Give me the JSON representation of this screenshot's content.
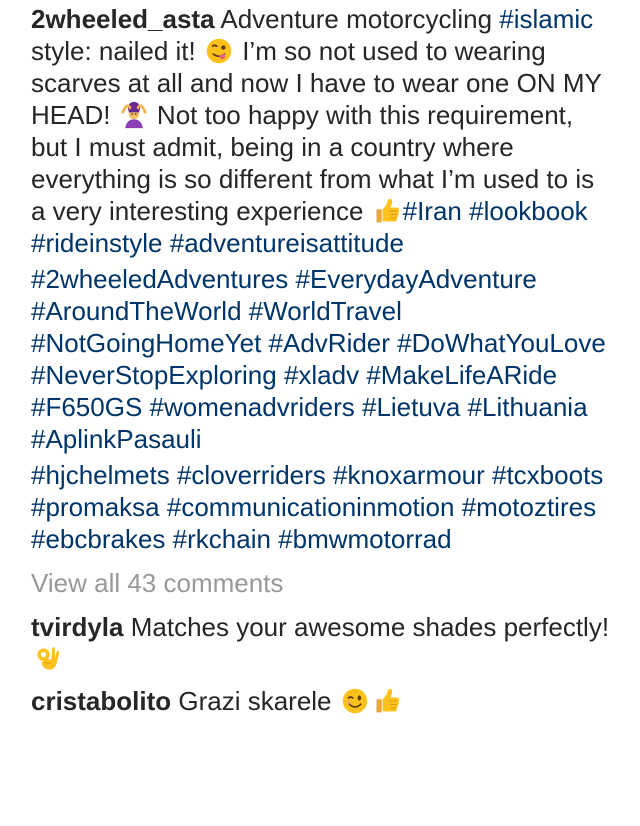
{
  "post": {
    "username": "2wheeled_asta",
    "caption_parts": [
      {
        "t": "text",
        "v": " Adventure motorcycling "
      },
      {
        "t": "tag",
        "v": "#islamic"
      },
      {
        "t": "text",
        "v": " style: nailed it! "
      },
      {
        "t": "emoji",
        "v": "winking-tongue-face"
      },
      {
        "t": "text",
        "v": " I’m so not used to wearing scarves at all and now I have to wear one ON MY HEAD! "
      },
      {
        "t": "emoji",
        "v": "woman-gesturing-ok"
      },
      {
        "t": "text",
        "v": " Not too happy with this requirement, but I must admit, being in a country where everything is so different from what I’m used to is a very interesting experience "
      },
      {
        "t": "emoji",
        "v": "thumbs-up"
      },
      {
        "t": "tag",
        "v": "#Iran"
      },
      {
        "t": "text",
        "v": " "
      },
      {
        "t": "tag",
        "v": "#lookbook"
      },
      {
        "t": "text",
        "v": " "
      },
      {
        "t": "tag",
        "v": "#rideinstyle"
      },
      {
        "t": "text",
        "v": " "
      },
      {
        "t": "tag",
        "v": "#adventureisattitude"
      }
    ],
    "hashtags_block_1": [
      "#2wheeledAdventures",
      "#EverydayAdventure",
      "#AroundTheWorld",
      "#WorldTravel",
      "#NotGoingHomeYet",
      "#AdvRider",
      "#DoWhatYouLove",
      "#NeverStopExploring",
      "#xladv",
      "#MakeLifeARide",
      "#F650GS",
      "#womenadvriders",
      "#Lietuva",
      "#Lithuania",
      "#AplinkPasauli"
    ],
    "hashtags_block_2": [
      "#hjchelmets",
      "#cloverriders",
      "#knoxarmour",
      "#tcxboots",
      "#promaksa",
      "#communicationinmotion",
      "#motoztires",
      "#ebcbrakes",
      "#rkchain",
      "#bmwmotorrad"
    ]
  },
  "view_all_comments": "View all 43 comments",
  "comments": [
    {
      "username": "tvirdyla",
      "text": "Matches your awesome shades perfectly!",
      "emojis": [
        "ok-hand"
      ]
    },
    {
      "username": "cristabolito",
      "text": "Grazi skarele",
      "emojis": [
        "winking-face",
        "thumbs-up"
      ]
    }
  ],
  "colors": {
    "hashtag": "#003569",
    "text": "#262626",
    "muted": "#999999"
  }
}
